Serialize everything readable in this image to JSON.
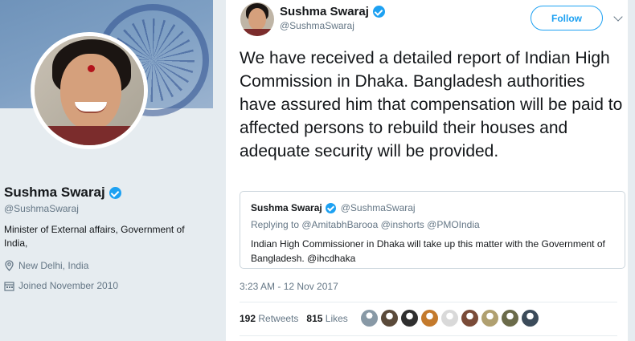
{
  "profile": {
    "name": "Sushma Swaraj",
    "handle": "@SushmaSwaraj",
    "bio": "Minister of External affairs, Government of India,",
    "location": "New Delhi, India",
    "joined": "Joined November 2010"
  },
  "tweet": {
    "author_name": "Sushma Swaraj",
    "author_handle": "@SushmaSwaraj",
    "follow_label": "Follow",
    "text": "We have received a detailed report of Indian High Commission in Dhaka. Bangladesh authorities have assured him that compensation will be paid to affected persons to rebuild their houses and adequate security will be provided.",
    "timestamp": "3:23 AM - 12 Nov 2017",
    "retweets_count": "192",
    "retweets_label": "Retweets",
    "likes_count": "815",
    "likes_label": "Likes",
    "quoted": {
      "author_name": "Sushma Swaraj",
      "author_handle": "@SushmaSwaraj",
      "replying_to": "Replying to @AmitabhBarooa @inshorts @PMOIndia",
      "text": "Indian High Commissioner in Dhaka will take up this matter with the Government of Bangladesh. @ihcdhaka"
    }
  },
  "colors": {
    "accent": "#1da1f2",
    "muted": "#657786",
    "text": "#14171a",
    "page_bg": "#e6ecf0"
  },
  "likers": [
    {
      "icon": "avatar-default",
      "color": "#8899a6"
    },
    {
      "icon": "avatar-photo",
      "color": "#5a4a3a"
    },
    {
      "icon": "avatar-photo",
      "color": "#2f2f2f"
    },
    {
      "icon": "avatar-photo",
      "color": "#c47a2c"
    },
    {
      "icon": "avatar-photo",
      "color": "#d9d9d9"
    },
    {
      "icon": "avatar-photo",
      "color": "#7a4b38"
    },
    {
      "icon": "avatar-photo",
      "color": "#b0a070"
    },
    {
      "icon": "avatar-photo",
      "color": "#6b6b4a"
    },
    {
      "icon": "avatar-photo",
      "color": "#3b4b5a"
    }
  ]
}
